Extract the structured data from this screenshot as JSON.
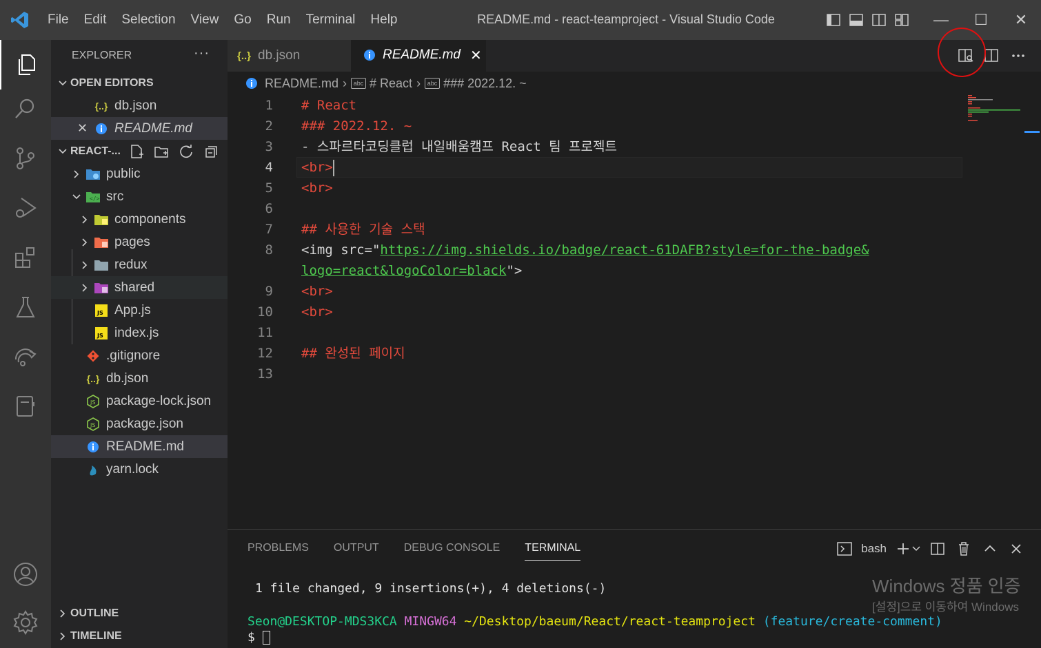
{
  "window": {
    "title": "README.md - react-teamproject - Visual Studio Code",
    "menu": [
      "File",
      "Edit",
      "Selection",
      "View",
      "Go",
      "Run",
      "Terminal",
      "Help"
    ],
    "controls": {
      "minimize": "—",
      "maximize": "☐",
      "close": "✕"
    }
  },
  "activity_bar": {
    "items": [
      "explorer-icon",
      "search-icon",
      "source-control-icon",
      "run-debug-icon",
      "extensions-icon",
      "testing-icon",
      "remote-icon",
      "notebook-icon"
    ],
    "bottom": [
      "account-icon",
      "settings-gear-icon"
    ]
  },
  "sidebar": {
    "title": "EXPLORER",
    "more": "···",
    "open_editors": {
      "label": "OPEN EDITORS",
      "items": [
        {
          "name": "db.json",
          "icon": "{..}"
        },
        {
          "name": "README.md",
          "close": "✕"
        }
      ]
    },
    "project": {
      "label": "REACT-...",
      "tree": [
        {
          "name": "public"
        },
        {
          "name": "src"
        },
        {
          "name": "components"
        },
        {
          "name": "pages"
        },
        {
          "name": "redux"
        },
        {
          "name": "shared"
        },
        {
          "name": "App.js"
        },
        {
          "name": "index.js"
        },
        {
          "name": ".gitignore"
        },
        {
          "name": "db.json"
        },
        {
          "name": "package-lock.json"
        },
        {
          "name": "package.json"
        },
        {
          "name": "README.md"
        },
        {
          "name": "yarn.lock"
        }
      ]
    },
    "outline": "OUTLINE",
    "timeline": "TIMELINE"
  },
  "tabs": [
    {
      "label": "db.json",
      "icon": "{..}"
    },
    {
      "label": "README.md",
      "close": "✕"
    }
  ],
  "breadcrumb": {
    "file": "README.md",
    "items": [
      "# React",
      "### 2022.12. ~"
    ],
    "abc": "abc"
  },
  "editor": {
    "lines": [
      {
        "n": "1",
        "text": "# React"
      },
      {
        "n": "2",
        "text": "### 2022.12. ~"
      },
      {
        "n": "3",
        "text": "- 스파르타코딩클럽 내일배움캠프 React 팀 프로젝트"
      },
      {
        "n": "4",
        "text": "<br>"
      },
      {
        "n": "5",
        "text": "<br>"
      },
      {
        "n": "6",
        "text": ""
      },
      {
        "n": "7",
        "text": "## 사용한 기술 스택"
      },
      {
        "n": "8",
        "text_a": "<img src=\"",
        "url_a": "https://img.shields.io/badge/react-61DAFB?style=for-the-badge&",
        "url_b": "logo=react&logoColor=black",
        "text_b": "\">"
      },
      {
        "n": "9",
        "text": "<br>"
      },
      {
        "n": "10",
        "text": "<br>"
      },
      {
        "n": "11",
        "text": ""
      },
      {
        "n": "12",
        "text": "## 완성된 페이지"
      },
      {
        "n": "13",
        "text": ""
      }
    ]
  },
  "panel": {
    "tabs": [
      "PROBLEMS",
      "OUTPUT",
      "DEBUG CONSOLE",
      "TERMINAL"
    ],
    "shell": "bash",
    "terminal": {
      "line1": "1 file changed, 9 insertions(+), 4 deletions(-)",
      "user": "Seon@DESKTOP-MDS3KCA",
      "env": "MINGW64",
      "path": "~/Desktop/baeum/React/react-teamproject",
      "branch": "(feature/create-comment)",
      "prompt": "$"
    },
    "watermark_title": "Windows 정품 인증",
    "watermark_sub": "[설정]으로 이동하여 Windows"
  },
  "colors": {
    "accent": "#3794ff",
    "annotation_circle": "#e01010",
    "markdown_heading": "#e34a3c",
    "link": "#4ec94e"
  }
}
